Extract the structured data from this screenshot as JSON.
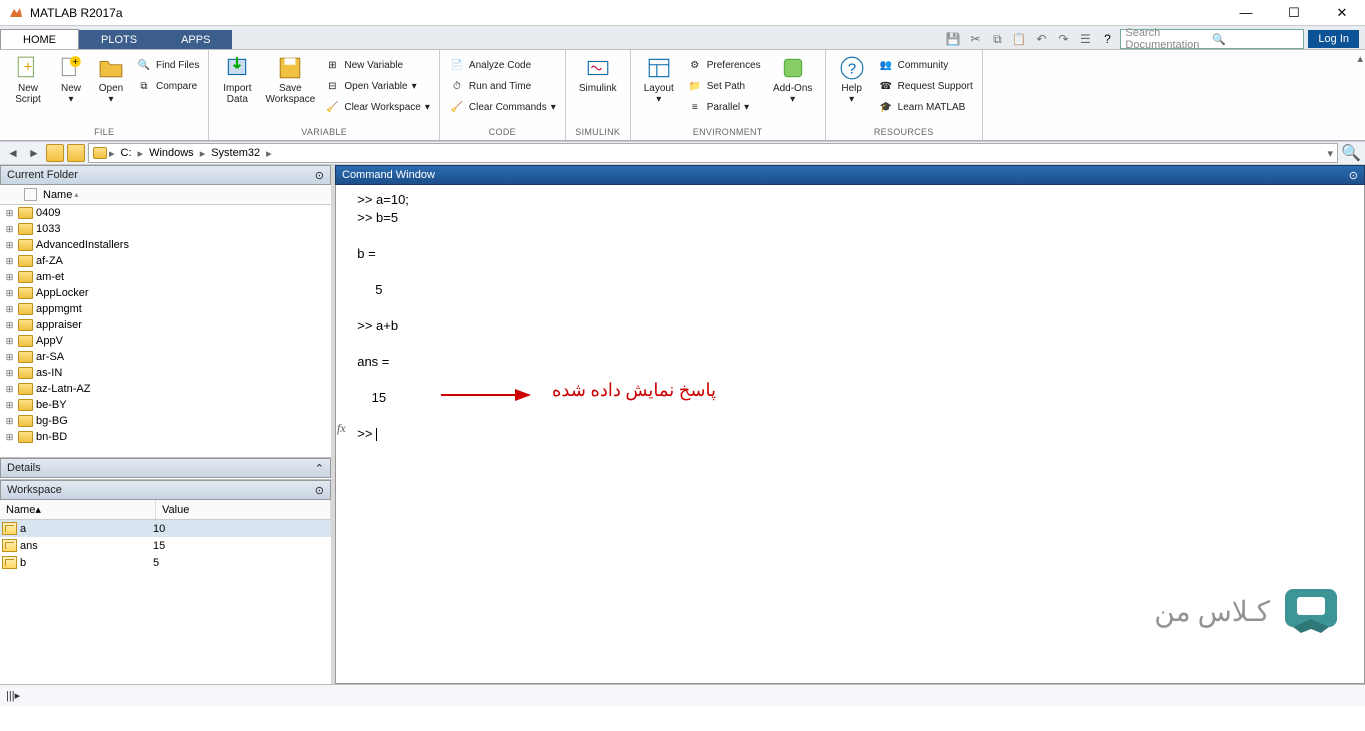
{
  "title": "MATLAB R2017a",
  "tabs": [
    "HOME",
    "PLOTS",
    "APPS"
  ],
  "search_placeholder": "Search Documentation",
  "login": "Log In",
  "ribbon": {
    "file": {
      "label": "FILE",
      "new_script": "New\nScript",
      "new": "New",
      "open": "Open",
      "find_files": "Find Files",
      "compare": "Compare"
    },
    "variable": {
      "label": "VARIABLE",
      "import_data": "Import\nData",
      "save_ws": "Save\nWorkspace",
      "new_var": "New Variable",
      "open_var": "Open Variable",
      "clear_ws": "Clear Workspace"
    },
    "code": {
      "label": "CODE",
      "analyze": "Analyze Code",
      "run_time": "Run and Time",
      "clear_cmds": "Clear Commands"
    },
    "simulink": {
      "label": "SIMULINK",
      "btn": "Simulink"
    },
    "environment": {
      "label": "ENVIRONMENT",
      "layout": "Layout",
      "prefs": "Preferences",
      "set_path": "Set Path",
      "parallel": "Parallel",
      "addons": "Add-Ons"
    },
    "resources": {
      "label": "RESOURCES",
      "help": "Help",
      "community": "Community",
      "support": "Request Support",
      "learn": "Learn MATLAB"
    }
  },
  "breadcrumb": [
    "C:",
    "Windows",
    "System32"
  ],
  "panels": {
    "current_folder": "Current Folder",
    "name_col": "Name",
    "details": "Details",
    "workspace": "Workspace",
    "command_window": "Command Window"
  },
  "folders": [
    "0409",
    "1033",
    "AdvancedInstallers",
    "af-ZA",
    "am-et",
    "AppLocker",
    "appmgmt",
    "appraiser",
    "AppV",
    "ar-SA",
    "as-IN",
    "az-Latn-AZ",
    "be-BY",
    "bg-BG",
    "bn-BD"
  ],
  "workspace_cols": {
    "name": "Name",
    "value": "Value"
  },
  "workspace_vars": [
    {
      "name": "a",
      "value": "10"
    },
    {
      "name": "ans",
      "value": "15"
    },
    {
      "name": "b",
      "value": "5"
    }
  ],
  "cmd_lines": [
    ">> a=10;",
    ">> b=5",
    "",
    "b =",
    "",
    "     5",
    "",
    ">> a+b",
    "",
    "ans =",
    "",
    "    15",
    "",
    ">> "
  ],
  "annotation_text": "پاسخ نمایش داده شده",
  "watermark_text": "کـلاس من"
}
